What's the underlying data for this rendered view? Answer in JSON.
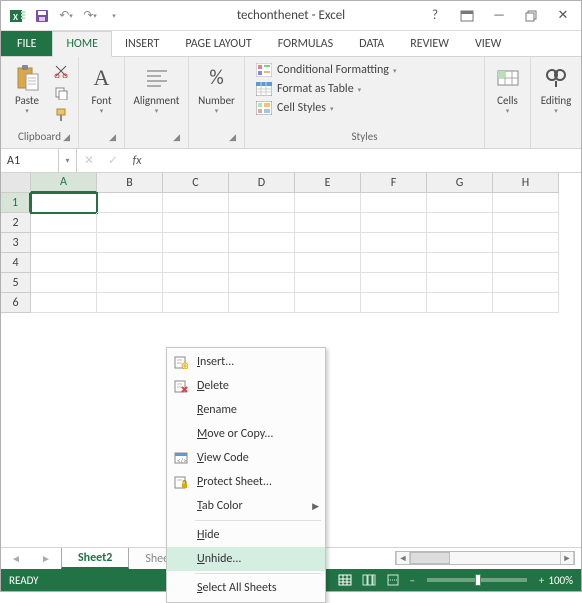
{
  "title": "techonthenet - Excel",
  "qat": {
    "excel": "X",
    "save": "💾",
    "undo": "↶",
    "redo": "↷"
  },
  "sys": {
    "help": "?",
    "ribbon": "▭",
    "min": "—",
    "restore": "❐",
    "close": "✕"
  },
  "tabs": {
    "file": "FILE",
    "home": "HOME",
    "insert": "INSERT",
    "page_layout": "PAGE LAYOUT",
    "formulas": "FORMULAS",
    "data": "DATA",
    "review": "REVIEW",
    "view": "VIEW"
  },
  "ribbon": {
    "clipboard": {
      "label": "Clipboard",
      "paste": "Paste"
    },
    "font": {
      "label": "Font",
      "btn": "Font",
      "sample": "A"
    },
    "alignment": {
      "label": "Alignment"
    },
    "number": {
      "label": "Number",
      "pct": "%"
    },
    "styles": {
      "label": "Styles",
      "cond": "Conditional Formatting",
      "table": "Format as Table",
      "cell": "Cell Styles"
    },
    "cells": {
      "label": "Cells"
    },
    "editing": {
      "label": "Editing"
    }
  },
  "namebox": "A1",
  "fx_label": "fx",
  "columns": [
    "A",
    "B",
    "C",
    "D",
    "E",
    "F",
    "G",
    "H"
  ],
  "rows": [
    "1",
    "2",
    "3",
    "4",
    "5",
    "6"
  ],
  "selected_col": 0,
  "selected_row": 0,
  "sheets": {
    "active": "Sheet2",
    "next": "Sheet3"
  },
  "status": {
    "ready": "READY",
    "zoom": "100%"
  },
  "context_menu": {
    "insert": "Insert...",
    "delete": "Delete",
    "rename": "Rename",
    "move": "Move or Copy...",
    "view_code": "View Code",
    "protect": "Protect Sheet...",
    "tab_color": "Tab Color",
    "hide": "Hide",
    "unhide": "Unhide...",
    "select_all": "Select All Sheets"
  }
}
